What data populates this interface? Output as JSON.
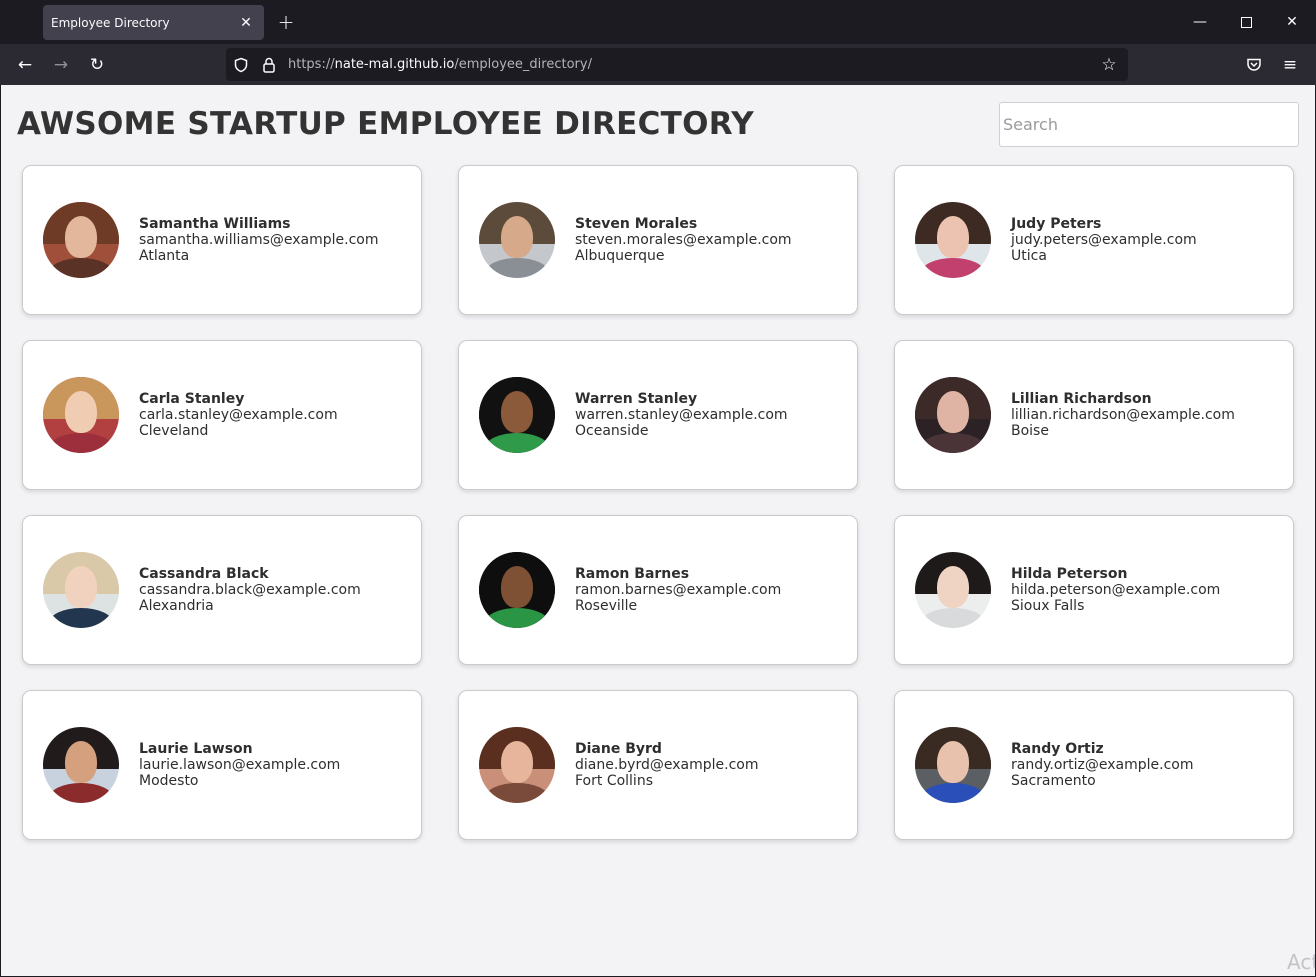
{
  "browser": {
    "tab_title": "Employee Directory",
    "url_prefix": "https://",
    "url_host": "nate-mal.github.io",
    "url_path": "/employee_directory/"
  },
  "page": {
    "title": "AWSOME STARTUP EMPLOYEE DIRECTORY",
    "search_placeholder": "Search",
    "watermark": "Act"
  },
  "employees": [
    {
      "name": "Samantha Williams",
      "email": "samantha.williams@example.com",
      "city": "Atlanta",
      "bg": "#a0503a",
      "hair": "#6e3b26",
      "skin": "#e2b79b",
      "shirt": "#5a3326"
    },
    {
      "name": "Steven Morales",
      "email": "steven.morales@example.com",
      "city": "Albuquerque",
      "bg": "#c4c8cc",
      "hair": "#5c4a3a",
      "skin": "#d6a98a",
      "shirt": "#8a8f96"
    },
    {
      "name": "Judy Peters",
      "email": "judy.peters@example.com",
      "city": "Utica",
      "bg": "#dfe6ea",
      "hair": "#3d2a22",
      "skin": "#ecc3b0",
      "shirt": "#c2406e"
    },
    {
      "name": "Carla Stanley",
      "email": "carla.stanley@example.com",
      "city": "Cleveland",
      "bg": "#b34040",
      "hair": "#c9965c",
      "skin": "#f0cdb2",
      "shirt": "#9c2f3b"
    },
    {
      "name": "Warren Stanley",
      "email": "warren.stanley@example.com",
      "city": "Oceanside",
      "bg": "#111111",
      "hair": "#111111",
      "skin": "#8a5a3a",
      "shirt": "#2f9a4a"
    },
    {
      "name": "Lillian Richardson",
      "email": "lillian.richardson@example.com",
      "city": "Boise",
      "bg": "#2c2124",
      "hair": "#3b2a28",
      "skin": "#e0b4a5",
      "shirt": "#4a3438"
    },
    {
      "name": "Cassandra Black",
      "email": "cassandra.black@example.com",
      "city": "Alexandria",
      "bg": "#dde2e3",
      "hair": "#d9c9a8",
      "skin": "#f1d2bf",
      "shirt": "#23364f"
    },
    {
      "name": "Ramon Barnes",
      "email": "ramon.barnes@example.com",
      "city": "Roseville",
      "bg": "#0e0e0e",
      "hair": "#0e0e0e",
      "skin": "#7e5034",
      "shirt": "#2a9544"
    },
    {
      "name": "Hilda Peterson",
      "email": "hilda.peterson@example.com",
      "city": "Sioux Falls",
      "bg": "#eceeee",
      "hair": "#1e1a1a",
      "skin": "#efd3c3",
      "shirt": "#d8dadb"
    },
    {
      "name": "Laurie Lawson",
      "email": "laurie.lawson@example.com",
      "city": "Modesto",
      "bg": "#c7d2de",
      "hair": "#221b1b",
      "skin": "#d4a07e",
      "shirt": "#8c2b2b"
    },
    {
      "name": "Diane Byrd",
      "email": "diane.byrd@example.com",
      "city": "Fort Collins",
      "bg": "#c98f78",
      "hair": "#5a2f1f",
      "skin": "#e6b59b",
      "shirt": "#7a4a3a"
    },
    {
      "name": "Randy Ortiz",
      "email": "randy.ortiz@example.com",
      "city": "Sacramento",
      "bg": "#5b5e63",
      "hair": "#3a2b22",
      "skin": "#e8c2ad",
      "shirt": "#2a4fb8"
    }
  ]
}
